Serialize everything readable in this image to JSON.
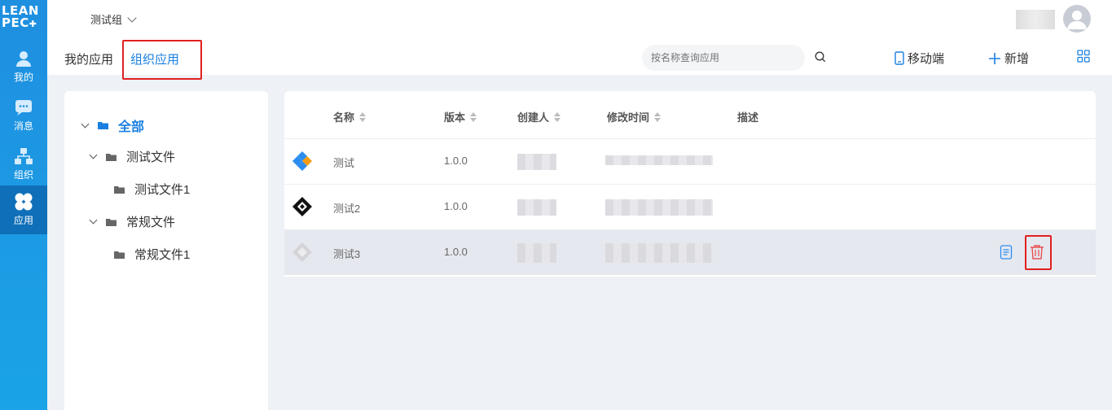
{
  "sidebar": {
    "logo_line1": "LEAN",
    "logo_line2": "PEC",
    "items": [
      {
        "label": "我的",
        "icon": "user-icon"
      },
      {
        "label": "消息",
        "icon": "message-icon"
      },
      {
        "label": "组织",
        "icon": "org-icon"
      },
      {
        "label": "应用",
        "icon": "apps-icon",
        "active": true
      }
    ],
    "color": "#1f8fe0"
  },
  "header": {
    "group_name": "测试组",
    "tabs": [
      {
        "label": "我的应用"
      },
      {
        "label": "组织应用",
        "active": true
      }
    ],
    "search_placeholder": "按名称查询应用",
    "mobile_label": "移动端",
    "add_label": "新增"
  },
  "tree": {
    "root": "全部",
    "nodes": [
      {
        "label": "测试文件",
        "children": [
          "测试文件1"
        ]
      },
      {
        "label": "常规文件",
        "children": [
          "常规文件1"
        ]
      }
    ]
  },
  "table": {
    "columns": [
      "名称",
      "版本",
      "创建人",
      "修改时间",
      "描述"
    ],
    "rows": [
      {
        "name": "测试",
        "version": "1.0.0",
        "icon": "diamond-orange-blue-icon"
      },
      {
        "name": "测试2",
        "version": "1.0.0",
        "icon": "diamond-black-icon"
      },
      {
        "name": "测试3",
        "version": "1.0.0",
        "icon": "diamond-gray-icon"
      }
    ]
  },
  "colors": {
    "accent": "#1a7fe0",
    "danger": "#e02020"
  }
}
